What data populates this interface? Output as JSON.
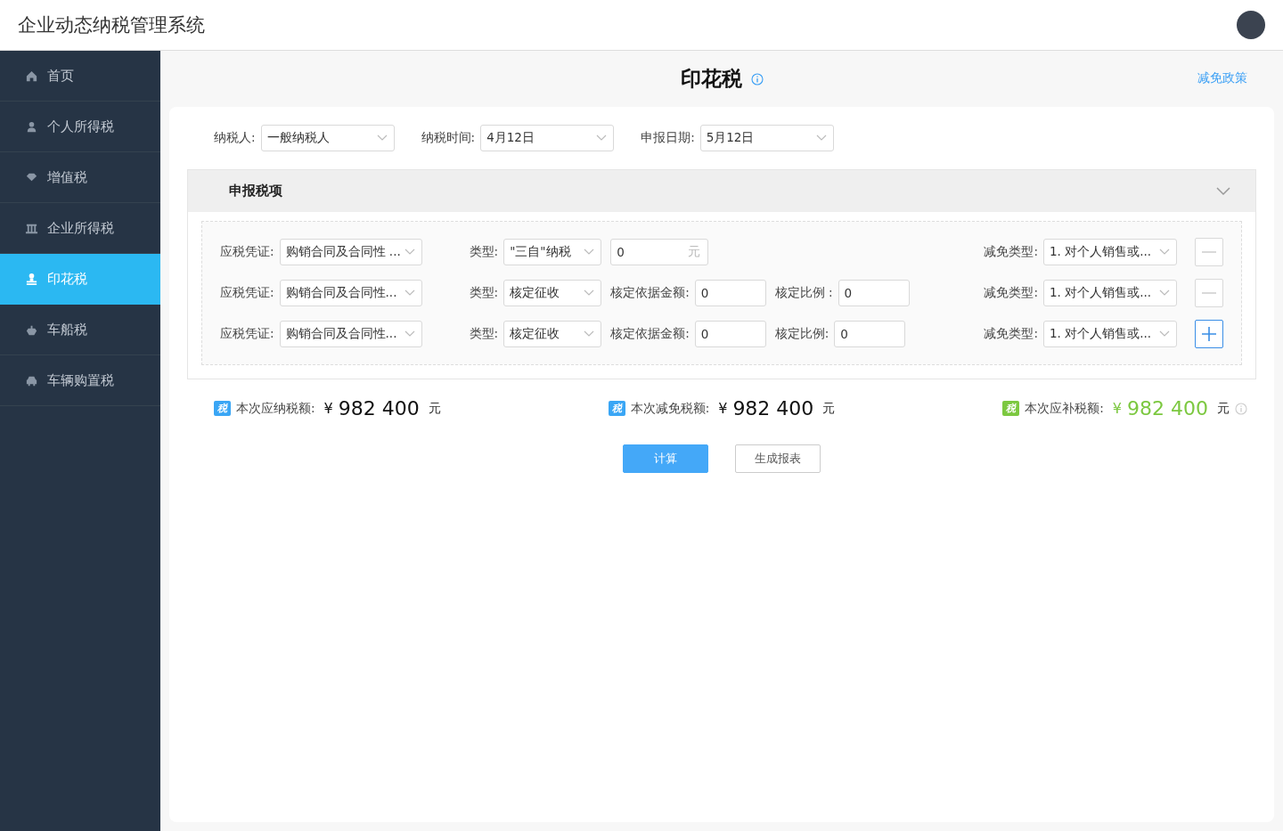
{
  "app": {
    "title": "企业动态纳税管理系统"
  },
  "sidebar": {
    "items": [
      {
        "label": "首页",
        "selected": false
      },
      {
        "label": "个人所得税",
        "selected": false
      },
      {
        "label": "增值税",
        "selected": false
      },
      {
        "label": "企业所得税",
        "selected": false
      },
      {
        "label": "印花税",
        "selected": true
      },
      {
        "label": "车船税",
        "selected": false
      },
      {
        "label": "车辆购置税",
        "selected": false
      }
    ]
  },
  "page": {
    "title": "印花税",
    "policy_link": "减免政策"
  },
  "filters": [
    {
      "label": "纳税人:",
      "value": "一般纳税人"
    },
    {
      "label": "纳税时间:",
      "value": "4月12日"
    },
    {
      "label": "申报日期:",
      "value": "5月12日"
    }
  ],
  "section": {
    "title": "申报税项",
    "expanded": true
  },
  "rows": [
    {
      "kind": "amount",
      "voucher_label": "应税凭证:",
      "voucher": "购销合同及合同性 ...",
      "type_label": "类型:",
      "type": "\"三自\"纳税",
      "amount": "0",
      "unit": "元",
      "reduction_label": "减免类型:",
      "reduction": "1. 对个人销售或...",
      "add_button": false
    },
    {
      "kind": "assessed",
      "voucher_label": "应税凭证:",
      "voucher": "购销合同及合同性...",
      "type_label": "类型:",
      "type": "核定征收",
      "base_label": "核定依据金额:",
      "base": "0",
      "ratio_label": "核定比例 :",
      "ratio": "0",
      "reduction_label": "减免类型:",
      "reduction": "1. 对个人销售或...",
      "add_button": false
    },
    {
      "kind": "assessed",
      "voucher_label": "应税凭证:",
      "voucher": "购销合同及合同性...",
      "type_label": "类型:",
      "type": "核定征收",
      "base_label": "核定依据金额:",
      "base": "0",
      "ratio_label": "核定比例:",
      "ratio": "0",
      "reduction_label": "减免类型:",
      "reduction": "1. 对个人销售或...",
      "add_button": true
    }
  ],
  "summary": [
    {
      "badge": "税",
      "label": "本次应纳税额:",
      "currency": "¥",
      "amount": "982 400",
      "unit": "元",
      "color": "#3aa6f5",
      "info": false
    },
    {
      "badge": "税",
      "label": "本次减免税额:",
      "currency": "¥",
      "amount": "982 400",
      "unit": "元",
      "color": "#3aa6f5",
      "info": false
    },
    {
      "badge": "税",
      "label": "本次应补税额:",
      "currency": "¥",
      "amount": "982 400",
      "unit": "元",
      "color": "#7cc840",
      "info": true
    }
  ],
  "buttons": [
    {
      "label": "计算",
      "kind": "primary"
    },
    {
      "label": "生成报表",
      "kind": "default"
    }
  ]
}
